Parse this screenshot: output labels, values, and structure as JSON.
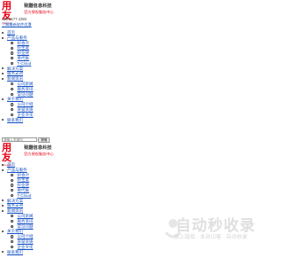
{
  "header_top": {
    "logo_text": "用友",
    "logo_sub": "yonyou",
    "brand_name": "致翻信息科技",
    "brand_tag": "官方授权服务中心",
    "phone": "139 6177 2280",
    "link": "了解最新软件优惠"
  },
  "nav_top": [
    {
      "label": "首页",
      "level": 0
    },
    {
      "label": "产品与服务",
      "level": 0
    },
    {
      "label": "好会计",
      "level": 1
    },
    {
      "label": "好生意",
      "level": 1
    },
    {
      "label": "好业财",
      "level": 1
    },
    {
      "label": "易代账",
      "level": 1
    },
    {
      "label": "T-Cloud",
      "level": 1
    },
    {
      "label": "解决方案",
      "level": 0
    },
    {
      "label": "服务支持",
      "level": 0
    },
    {
      "label": "新闻资讯",
      "level": 0
    },
    {
      "label": "公司新闻",
      "level": 1
    },
    {
      "label": "服务资讯",
      "level": 1
    },
    {
      "label": "常见问题",
      "level": 1
    },
    {
      "label": "关于我们",
      "level": 0
    },
    {
      "label": "公司介绍",
      "level": 1
    },
    {
      "label": "荣誉资质",
      "level": 1
    },
    {
      "label": "企业文化",
      "level": 1
    },
    {
      "label": "联系我们",
      "level": 0
    }
  ],
  "search": {
    "placeholder": "请输入关键词",
    "button": "搜索"
  },
  "header_bottom": {
    "logo_text": "用友",
    "logo_sub": "yonyou",
    "brand_name": "致翻信息科技",
    "brand_tag": "官方授权服务中心"
  },
  "nav_bottom": [
    {
      "label": "首页",
      "level": 0
    },
    {
      "label": "产品与服务",
      "level": 0
    },
    {
      "label": "好会计",
      "level": 1
    },
    {
      "label": "好生意",
      "level": 1
    },
    {
      "label": "好业财",
      "level": 1
    },
    {
      "label": "易代账",
      "level": 1
    },
    {
      "label": "T-Cloud",
      "level": 1
    },
    {
      "label": "解决方案",
      "level": 0
    },
    {
      "label": "服务支持",
      "level": 0
    },
    {
      "label": "新闻资讯",
      "level": 0
    },
    {
      "label": "公司新闻",
      "level": 1
    },
    {
      "label": "服务资讯",
      "level": 1
    },
    {
      "label": "常见问题",
      "level": 1
    },
    {
      "label": "关于我们",
      "level": 0
    },
    {
      "label": "公司介绍",
      "level": 1
    },
    {
      "label": "荣誉资质",
      "level": 1
    },
    {
      "label": "企业文化",
      "level": 1
    },
    {
      "label": "联系我们",
      "level": 0
    }
  ],
  "watermark": {
    "title": "自动秒收录",
    "subtitle": "放上链接 · 本站访客 · 自动收录"
  },
  "colors": {
    "brand_red": "#e60012",
    "link_blue": "#1a55c5"
  }
}
